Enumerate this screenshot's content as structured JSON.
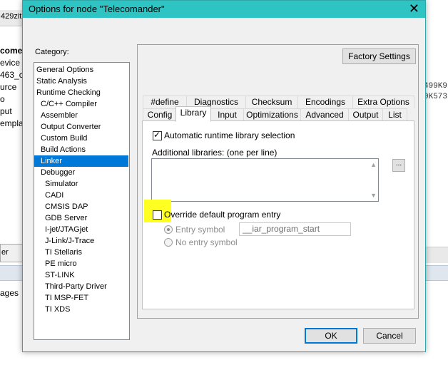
{
  "background": {
    "tab_fragment": "429zit",
    "lines": [
      "come",
      "evice",
      "463_c",
      "urce",
      "o",
      "put",
      "empla"
    ],
    "right_lines": [
      "499K9",
      "0K573"
    ],
    "bar_fragment": "er",
    "bottom_fragment": "ages"
  },
  "dialog": {
    "title": "Options for node \"Telecomander\"",
    "close_glyph": "✕",
    "category_label": "Category:",
    "categories": [
      "General Options",
      "Static Analysis",
      "Runtime Checking",
      "C/C++ Compiler",
      "Assembler",
      "Output Converter",
      "Custom Build",
      "Build Actions",
      "Linker",
      "Debugger",
      "Simulator",
      "CADI",
      "CMSIS DAP",
      "GDB Server",
      "I-jet/JTAGjet",
      "J-Link/J-Trace",
      "TI Stellaris",
      "PE micro",
      "ST-LINK",
      "Third-Party Driver",
      "TI MSP-FET",
      "TI XDS"
    ],
    "selected_category": "Linker",
    "factory_settings": "Factory Settings",
    "tabs_row1": [
      "#define",
      "Diagnostics",
      "Checksum",
      "Encodings",
      "Extra Options"
    ],
    "tabs_row2": [
      "Config",
      "Library",
      "Input",
      "Optimizations",
      "Advanced",
      "Output",
      "List"
    ],
    "active_tab": "Library",
    "library": {
      "auto_runtime_label": "Automatic runtime library selection",
      "auto_runtime_checked": true,
      "additional_label": "Additional libraries: (one per line)",
      "additional_value": "",
      "browse_label": "...",
      "override_label": "Override default program entry",
      "override_checked": false,
      "entry_symbol_label": "Entry symbol",
      "entry_symbol_value": "__iar_program_start",
      "no_entry_symbol_label": "No entry symbol"
    },
    "ok": "OK",
    "cancel": "Cancel",
    "highlight_color": "#ffff21",
    "title_color": "#2ec4c4"
  }
}
